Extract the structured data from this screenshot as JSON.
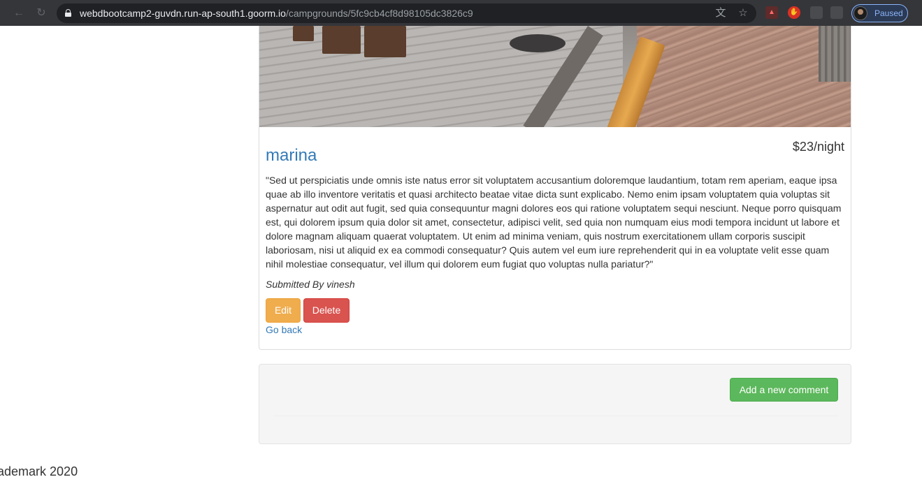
{
  "browser": {
    "url_host": "webdbootcamp2-guvdn.run-ap-south1.goorm.io",
    "url_path": "/campgrounds/5fc9cb4cf8d98105dc3826c9",
    "profile_status": "Paused",
    "icons": [
      "back-icon",
      "reload-icon",
      "lock-icon",
      "translate-icon",
      "bookmark-star-icon",
      "pdf-extension-icon",
      "adblock-extension-icon",
      "extension-icon",
      "extensions-menu-icon",
      "profile-avatar"
    ]
  },
  "campground": {
    "name": "marina",
    "price": "$23/night",
    "description": "\"Sed ut perspiciatis unde omnis iste natus error sit voluptatem accusantium doloremque laudantium, totam rem aperiam, eaque ipsa quae ab illo inventore veritatis et quasi architecto beatae vitae dicta sunt explicabo. Nemo enim ipsam voluptatem quia voluptas sit aspernatur aut odit aut fugit, sed quia consequuntur magni dolores eos qui ratione voluptatem sequi nesciunt. Neque porro quisquam est, qui dolorem ipsum quia dolor sit amet, consectetur, adipisci velit, sed quia non numquam eius modi tempora incidunt ut labore et dolore magnam aliquam quaerat voluptatem. Ut enim ad minima veniam, quis nostrum exercitationem ullam corporis suscipit laboriosam, nisi ut aliquid ex ea commodi consequatur? Quis autem vel eum iure reprehenderit qui in ea voluptate velit esse quam nihil molestiae consequatur, vel illum qui dolorem eum fugiat quo voluptas nulla pariatur?\"",
    "submitted_by": "Submitted By vinesh",
    "edit_label": "Edit",
    "delete_label": "Delete",
    "go_back_label": "Go back"
  },
  "comments": {
    "add_label": "Add a new comment"
  },
  "footer": {
    "text": "ademark 2020"
  },
  "colors": {
    "link": "#337ab7",
    "edit": "#f0ad4e",
    "delete": "#d9534f",
    "success": "#5cb85c"
  }
}
